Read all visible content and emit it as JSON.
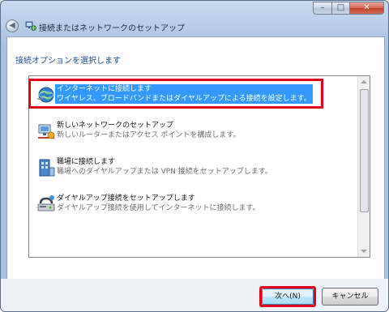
{
  "window": {
    "title": "接続またはネットワークのセットアップ",
    "back_glyph": "◀",
    "caption_buttons": {
      "minimize": "–",
      "maximize": "□",
      "close": "✕"
    }
  },
  "content": {
    "heading": "接続オプションを選択します",
    "options": [
      {
        "title": "インターネットに接続します",
        "description": "ワイヤレス、ブロードバンドまたはダイヤルアップによる接続を設定します。",
        "icon": "globe-network-icon",
        "selected": true
      },
      {
        "title": "新しいネットワークのセットアップ",
        "description": "新しいルーターまたはアクセス ポイントを構成します。",
        "icon": "router-icon",
        "selected": false
      },
      {
        "title": "職場に接続します",
        "description": "職場へのダイヤルアップまたは VPN 接続をセットアップします。",
        "icon": "workplace-icon",
        "selected": false
      },
      {
        "title": "ダイヤルアップ接続をセットアップします",
        "description": "ダイヤルアップ接続を使用してインターネットに接続します。",
        "icon": "dialup-modem-icon",
        "selected": false
      }
    ]
  },
  "footer": {
    "next_label": "次へ(N)",
    "cancel_label": "キャンセル"
  },
  "colors": {
    "selection": "#3399ff",
    "annotation_red": "#e0001a",
    "heading_blue": "#1e4e8c"
  }
}
